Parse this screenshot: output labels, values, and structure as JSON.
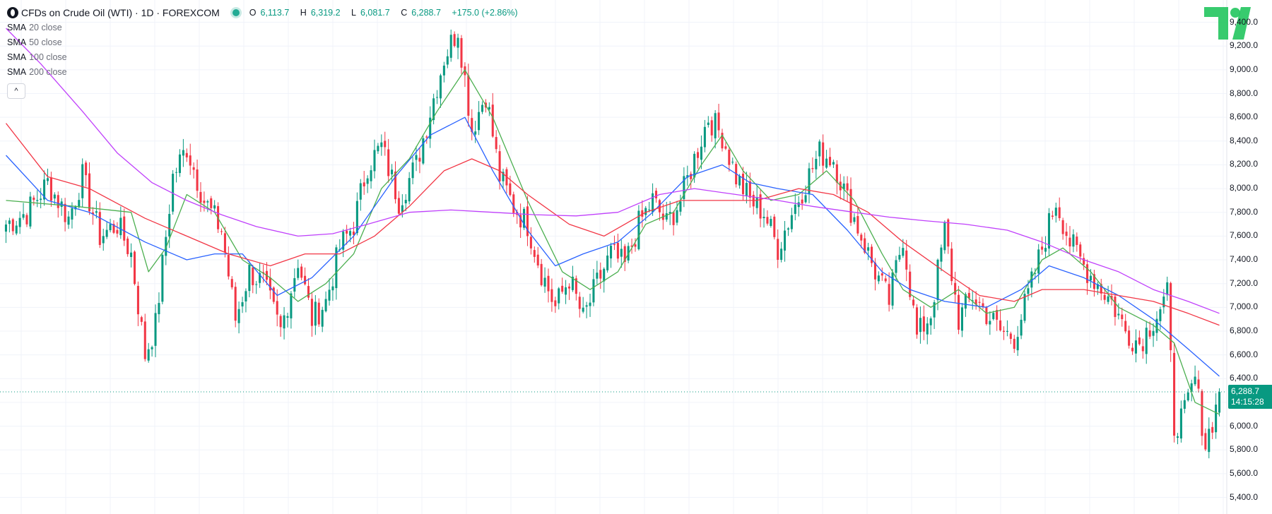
{
  "header": {
    "symbol_title": "CFDs on Crude Oil (WTI) · 1D · FOREXCOM",
    "ohlc": [
      {
        "key": "O",
        "value": "6,113.7"
      },
      {
        "key": "H",
        "value": "6,319.2"
      },
      {
        "key": "L",
        "value": "6,081.7"
      },
      {
        "key": "C",
        "value": "6,288.7"
      },
      {
        "key": "",
        "value": "+175.0 (+2.86%)"
      }
    ]
  },
  "indicators": [
    {
      "name": "SMA",
      "params": "20 close",
      "color": "#4caf50"
    },
    {
      "name": "SMA",
      "params": "50 close",
      "color": "#2962ff"
    },
    {
      "name": "SMA",
      "params": "100 close",
      "color": "#f23645"
    },
    {
      "name": "SMA",
      "params": "200 close",
      "color": "#c040fb"
    }
  ],
  "collapse_button": {
    "label": "^"
  },
  "price_tag": {
    "price": "6,288.7",
    "countdown": "14:15:28"
  },
  "colors": {
    "up": "#089981",
    "down": "#f23645",
    "grid": "#f0f3fa",
    "last_price_line": "#089981"
  },
  "chart_data": {
    "type": "candlestick",
    "y_axis": {
      "ticks": [
        9400,
        9200,
        9000,
        8800,
        8600,
        8400,
        8200,
        8000,
        7800,
        7600,
        7400,
        7200,
        7000,
        6800,
        6600,
        6400,
        6200,
        6000,
        5800,
        5600,
        5400
      ],
      "labels": [
        "9,400.0",
        "9,200.0",
        "9,000.0",
        "8,800.0",
        "8,600.0",
        "8,400.0",
        "8,200.0",
        "8,000.0",
        "7,800.0",
        "7,600.0",
        "7,400.0",
        "7,200.0",
        "7,000.0",
        "6,800.0",
        "6,600.0",
        "6,400.0",
        "6,200.0",
        "6,000.0",
        "5,800.0",
        "5,600.0",
        "5,400.0"
      ],
      "range": [
        5320,
        9540
      ]
    },
    "last_close": 6288.7,
    "close_path": [
      [
        0,
        7700
      ],
      [
        6,
        7800
      ],
      [
        12,
        8050
      ],
      [
        18,
        7750
      ],
      [
        22,
        8100
      ],
      [
        27,
        7600
      ],
      [
        32,
        7700
      ],
      [
        36,
        7450
      ],
      [
        40,
        6600
      ],
      [
        43,
        6850
      ],
      [
        48,
        8100
      ],
      [
        52,
        8350
      ],
      [
        57,
        7900
      ],
      [
        62,
        7650
      ],
      [
        66,
        6900
      ],
      [
        70,
        7300
      ],
      [
        74,
        7200
      ],
      [
        79,
        6800
      ],
      [
        84,
        7400
      ],
      [
        88,
        6900
      ],
      [
        92,
        7050
      ],
      [
        96,
        7500
      ],
      [
        100,
        7700
      ],
      [
        104,
        8200
      ],
      [
        108,
        8350
      ],
      [
        113,
        7900
      ],
      [
        118,
        8200
      ],
      [
        122,
        8650
      ],
      [
        126,
        9100
      ],
      [
        130,
        9350
      ],
      [
        134,
        8500
      ],
      [
        138,
        8800
      ],
      [
        142,
        8100
      ],
      [
        146,
        7850
      ],
      [
        150,
        7700
      ],
      [
        154,
        7300
      ],
      [
        158,
        7000
      ],
      [
        162,
        7250
      ],
      [
        166,
        6900
      ],
      [
        170,
        7200
      ],
      [
        174,
        7450
      ],
      [
        178,
        7350
      ],
      [
        182,
        7700
      ],
      [
        186,
        7900
      ],
      [
        190,
        7700
      ],
      [
        194,
        7900
      ],
      [
        198,
        8250
      ],
      [
        202,
        8600
      ],
      [
        206,
        8450
      ],
      [
        210,
        8100
      ],
      [
        214,
        7900
      ],
      [
        218,
        7800
      ],
      [
        222,
        7500
      ],
      [
        226,
        7800
      ],
      [
        230,
        8050
      ],
      [
        234,
        8300
      ],
      [
        238,
        8250
      ],
      [
        242,
        7900
      ],
      [
        246,
        7600
      ],
      [
        250,
        7300
      ],
      [
        254,
        7050
      ],
      [
        258,
        7600
      ],
      [
        262,
        6750
      ],
      [
        266,
        6950
      ],
      [
        270,
        7650
      ],
      [
        274,
        6900
      ],
      [
        278,
        7100
      ],
      [
        282,
        6950
      ],
      [
        286,
        6800
      ],
      [
        290,
        6750
      ],
      [
        294,
        7100
      ],
      [
        298,
        7500
      ],
      [
        302,
        7900
      ],
      [
        306,
        7550
      ],
      [
        310,
        7350
      ],
      [
        314,
        7200
      ],
      [
        318,
        7050
      ],
      [
        322,
        6800
      ],
      [
        326,
        6700
      ],
      [
        330,
        6900
      ],
      [
        334,
        7100
      ],
      [
        336,
        6000
      ],
      [
        339,
        6100
      ],
      [
        342,
        6400
      ],
      [
        345,
        5850
      ],
      [
        348,
        6150
      ],
      [
        349,
        6288.7
      ]
    ],
    "wick_extremes": {
      "high": 9450,
      "low": 5430
    },
    "sma20": [
      [
        0,
        7900
      ],
      [
        20,
        7850
      ],
      [
        36,
        7800
      ],
      [
        41,
        7300
      ],
      [
        46,
        7500
      ],
      [
        52,
        7950
      ],
      [
        60,
        7800
      ],
      [
        68,
        7400
      ],
      [
        76,
        7250
      ],
      [
        84,
        7050
      ],
      [
        92,
        7200
      ],
      [
        100,
        7450
      ],
      [
        108,
        8000
      ],
      [
        116,
        8250
      ],
      [
        124,
        8650
      ],
      [
        132,
        9000
      ],
      [
        140,
        8600
      ],
      [
        150,
        7900
      ],
      [
        160,
        7300
      ],
      [
        168,
        7150
      ],
      [
        176,
        7300
      ],
      [
        184,
        7700
      ],
      [
        192,
        7800
      ],
      [
        200,
        8200
      ],
      [
        206,
        8450
      ],
      [
        212,
        8150
      ],
      [
        220,
        7900
      ],
      [
        228,
        7950
      ],
      [
        236,
        8150
      ],
      [
        244,
        7900
      ],
      [
        252,
        7450
      ],
      [
        258,
        7150
      ],
      [
        266,
        7000
      ],
      [
        274,
        7150
      ],
      [
        282,
        6950
      ],
      [
        290,
        7000
      ],
      [
        298,
        7400
      ],
      [
        304,
        7500
      ],
      [
        312,
        7300
      ],
      [
        320,
        7000
      ],
      [
        330,
        6850
      ],
      [
        336,
        6700
      ],
      [
        342,
        6200
      ],
      [
        349,
        6100
      ]
    ],
    "sma50": [
      [
        0,
        8280
      ],
      [
        12,
        7900
      ],
      [
        24,
        7800
      ],
      [
        40,
        7550
      ],
      [
        52,
        7400
      ],
      [
        60,
        7450
      ],
      [
        68,
        7450
      ],
      [
        78,
        7100
      ],
      [
        88,
        7250
      ],
      [
        100,
        7600
      ],
      [
        112,
        8100
      ],
      [
        122,
        8450
      ],
      [
        132,
        8600
      ],
      [
        140,
        8150
      ],
      [
        150,
        7650
      ],
      [
        158,
        7350
      ],
      [
        166,
        7450
      ],
      [
        176,
        7550
      ],
      [
        186,
        7800
      ],
      [
        196,
        8100
      ],
      [
        206,
        8200
      ],
      [
        214,
        8050
      ],
      [
        222,
        8000
      ],
      [
        232,
        7950
      ],
      [
        242,
        7650
      ],
      [
        252,
        7300
      ],
      [
        260,
        7150
      ],
      [
        270,
        7050
      ],
      [
        282,
        7000
      ],
      [
        292,
        7150
      ],
      [
        300,
        7350
      ],
      [
        310,
        7250
      ],
      [
        320,
        7100
      ],
      [
        330,
        6900
      ],
      [
        340,
        6650
      ],
      [
        349,
        6420
      ]
    ],
    "sma100": [
      [
        0,
        8550
      ],
      [
        12,
        8100
      ],
      [
        24,
        8000
      ],
      [
        40,
        7750
      ],
      [
        52,
        7600
      ],
      [
        64,
        7450
      ],
      [
        76,
        7350
      ],
      [
        86,
        7450
      ],
      [
        96,
        7450
      ],
      [
        106,
        7600
      ],
      [
        116,
        7850
      ],
      [
        126,
        8150
      ],
      [
        134,
        8250
      ],
      [
        142,
        8150
      ],
      [
        150,
        7950
      ],
      [
        162,
        7700
      ],
      [
        172,
        7600
      ],
      [
        184,
        7800
      ],
      [
        194,
        7900
      ],
      [
        204,
        7900
      ],
      [
        216,
        7900
      ],
      [
        228,
        8000
      ],
      [
        238,
        7950
      ],
      [
        248,
        7800
      ],
      [
        258,
        7550
      ],
      [
        270,
        7300
      ],
      [
        280,
        7100
      ],
      [
        290,
        7050
      ],
      [
        298,
        7150
      ],
      [
        310,
        7150
      ],
      [
        320,
        7100
      ],
      [
        330,
        7050
      ],
      [
        340,
        6950
      ],
      [
        349,
        6850
      ]
    ],
    "sma200": [
      [
        0,
        9350
      ],
      [
        10,
        9050
      ],
      [
        22,
        8650
      ],
      [
        32,
        8300
      ],
      [
        42,
        8050
      ],
      [
        52,
        7900
      ],
      [
        62,
        7780
      ],
      [
        72,
        7680
      ],
      [
        84,
        7600
      ],
      [
        94,
        7620
      ],
      [
        104,
        7700
      ],
      [
        116,
        7800
      ],
      [
        128,
        7820
      ],
      [
        140,
        7800
      ],
      [
        152,
        7780
      ],
      [
        164,
        7770
      ],
      [
        176,
        7800
      ],
      [
        188,
        7950
      ],
      [
        198,
        8000
      ],
      [
        210,
        7950
      ],
      [
        222,
        7900
      ],
      [
        232,
        7850
      ],
      [
        244,
        7800
      ],
      [
        254,
        7760
      ],
      [
        264,
        7730
      ],
      [
        276,
        7700
      ],
      [
        288,
        7650
      ],
      [
        298,
        7550
      ],
      [
        310,
        7400
      ],
      [
        320,
        7300
      ],
      [
        330,
        7150
      ],
      [
        340,
        7050
      ],
      [
        349,
        6950
      ]
    ]
  }
}
